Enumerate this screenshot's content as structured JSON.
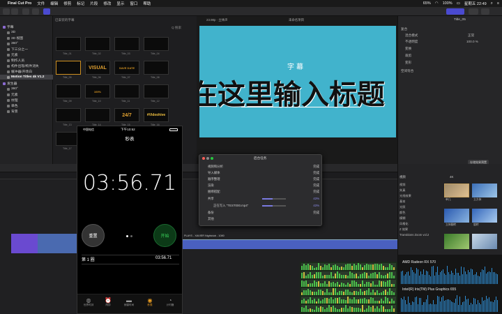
{
  "menubar": {
    "app_name": "Final Cut Pro",
    "items": [
      "文件",
      "编辑",
      "修剪",
      "标记",
      "片段",
      "修改",
      "显示",
      "窗口",
      "帮助"
    ],
    "battery": "100%",
    "network": "65%",
    "clock": "星期五 22:49"
  },
  "sidebar": {
    "items": [
      {
        "label": "字幕",
        "indent": 0,
        "selected": false
      },
      {
        "label": "3D",
        "indent": 1,
        "selected": false
      },
      {
        "label": "3D 视图",
        "indent": 1,
        "selected": false
      },
      {
        "label": "360°",
        "indent": 1,
        "selected": false
      },
      {
        "label": "下三分之一",
        "indent": 1,
        "selected": false
      },
      {
        "label": "元素",
        "indent": 1,
        "selected": false
      },
      {
        "label": "制作人员",
        "indent": 1,
        "selected": false
      },
      {
        "label": "构件出现/构件消失",
        "indent": 1,
        "selected": false
      },
      {
        "label": "缓冲器/开场白",
        "indent": 1,
        "selected": false
      },
      {
        "label": "Motion Titles 4k V1.2",
        "indent": 1,
        "selected": true
      },
      {
        "label": "发生器",
        "indent": 0,
        "selected": false
      },
      {
        "label": "360°",
        "indent": 1,
        "selected": false
      },
      {
        "label": "元素",
        "indent": 1,
        "selected": false
      },
      {
        "label": "纹理",
        "indent": 1,
        "selected": false
      },
      {
        "label": "单色",
        "indent": 1,
        "selected": false
      },
      {
        "label": "背景",
        "indent": 1,
        "selected": false
      }
    ]
  },
  "browser": {
    "header_left": "已安装的字幕",
    "header_right": "Q 搜索",
    "thumbs": [
      {
        "label": "Title_01",
        "text": ""
      },
      {
        "label": "Title_02",
        "text": ""
      },
      {
        "label": "Title_03",
        "text": ""
      },
      {
        "label": "Title_04",
        "text": ""
      },
      {
        "label": "Title_05",
        "text": ""
      },
      {
        "label": "Title_06",
        "text": "VISUAL"
      },
      {
        "label": "Title_07",
        "text": "SAVE DATE"
      },
      {
        "label": "Title_08",
        "text": ""
      },
      {
        "label": "Title_09",
        "text": ""
      },
      {
        "label": "Title_10",
        "text": "100%"
      },
      {
        "label": "Title_11",
        "text": ""
      },
      {
        "label": "Title_12",
        "text": ""
      },
      {
        "label": "Title_13",
        "text": ""
      },
      {
        "label": "Title_14",
        "text": ""
      },
      {
        "label": "Title_15",
        "text": "24/7"
      },
      {
        "label": "Title_16",
        "text": "#Videohive"
      },
      {
        "label": "Title_17",
        "text": ""
      }
    ]
  },
  "viewer": {
    "header": "23.98p · 立体声",
    "zoom": "未命名项目",
    "title_small": "字幕",
    "title_big": "在这里输入标题"
  },
  "inspector": {
    "title": "Title_05",
    "rows": [
      "复合",
      "混合模式",
      "不透明度",
      "变换",
      "裁剪",
      "变形",
      "空间符合"
    ],
    "values": {
      "blend": "正常",
      "opacity": "100.0 %"
    },
    "save_button": "存储效果预置"
  },
  "dialog": {
    "title": "后台任务",
    "rows": [
      {
        "label": "视频和分析",
        "status": "完成"
      },
      {
        "label": "导入媒体",
        "status": "完成"
      },
      {
        "label": "顺序整理",
        "status": "完成"
      },
      {
        "label": "渲染",
        "status": "完成"
      },
      {
        "label": "捆绑搭配",
        "status": "完成"
      },
      {
        "label": "共享",
        "status": "43%"
      },
      {
        "label": "正在写入 \"TEST000.mp4\"",
        "status": "43%"
      },
      {
        "label": "备份",
        "status": "完成"
      },
      {
        "label": "其他",
        "status": ""
      }
    ]
  },
  "phone": {
    "carrier": "中国电信",
    "time": "下午10:52",
    "battery": "",
    "title": "秒表",
    "stopwatch": "03:56.71",
    "reset_label": "重置",
    "start_label": "开始",
    "lap_label": "第 1 圈",
    "lap_time": "03:56.71",
    "tabs": [
      "世界时钟",
      "闹钟",
      "就寝时间",
      "秒表",
      "计时器"
    ]
  },
  "effects": {
    "header_left": "视频",
    "header_right": "4K",
    "categories": [
      "视频",
      "失真",
      "光线效果",
      "基本",
      "光照",
      "颜色",
      "模糊",
      "风格化",
      "Z 效果",
      "Transitions Zoom vol.2"
    ],
    "items": [
      {
        "label": "单几"
      },
      {
        "label": "立方体"
      },
      {
        "label": "立体翻转"
      },
      {
        "label": "旋转"
      },
      {
        "label": "位置"
      },
      {
        "label": "缩放"
      }
    ]
  },
  "gpu": {
    "gpu1": "AMD Radeon RX 570",
    "gpu2": "Intel(R) Iris(TM) Plus Graphics 655"
  },
  "timeline": {
    "clip_label": "PLAYS - XAVIER Nightclub - 1080"
  }
}
